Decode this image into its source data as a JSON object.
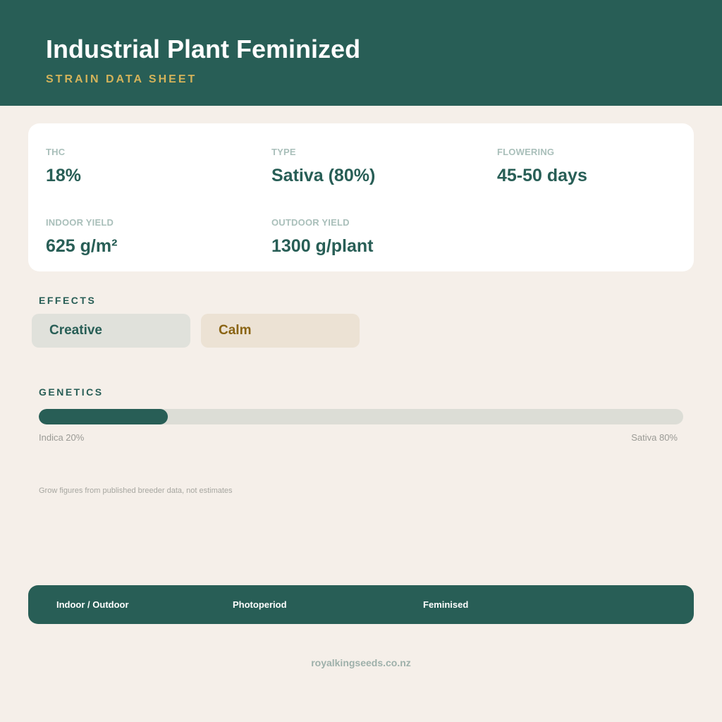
{
  "header": {
    "title": "Industrial Plant Feminized",
    "subtitle": "STRAIN DATA SHEET"
  },
  "stats": {
    "thc": {
      "label": "THC",
      "value": "18%"
    },
    "type": {
      "label": "TYPE",
      "value": "Sativa (80%)"
    },
    "flowering": {
      "label": "FLOWERING",
      "value": "45-50 days"
    },
    "indoor_yield": {
      "label": "INDOOR YIELD",
      "value": "625 g/m²"
    },
    "outdoor_yield": {
      "label": "OUTDOOR YIELD",
      "value": "1300 g/plant"
    }
  },
  "effects": {
    "heading": "EFFECTS",
    "items": [
      "Creative",
      "Calm"
    ]
  },
  "genetics": {
    "heading": "GENETICS",
    "indica_label": "Indica 20%",
    "sativa_label": "Sativa 80%",
    "indica_fraction": 0.2
  },
  "note": "Grow figures from published breeder data, not estimates",
  "footer": {
    "items": [
      "Indoor / Outdoor",
      "Photoperiod",
      "Feminised"
    ]
  },
  "website": "royalkingseeds.co.nz",
  "colors": {
    "primary": "#285e56",
    "accent": "#d4b35a",
    "background": "#f5efe9"
  }
}
